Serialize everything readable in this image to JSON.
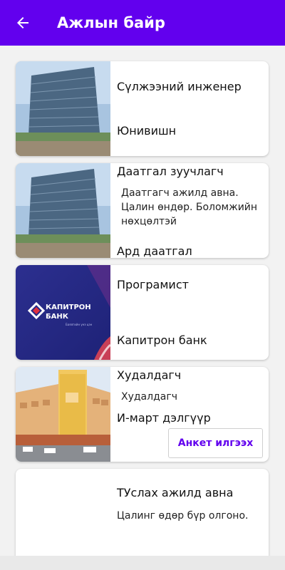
{
  "appbar": {
    "title": "Ажлын байр",
    "back_icon": "arrow-left-icon",
    "color": "#6200ee"
  },
  "jobs": [
    {
      "title": "Сүлжээний инженер",
      "description": "",
      "company": "Юнивишн",
      "image": "office-tower-photo"
    },
    {
      "title": "Даатгал зуучлагч",
      "description": "Даатгагч ажилд авна. Цалин өндөр. Боломжийн нөхцөлтэй",
      "company": "Ард даатгал",
      "image": "office-tower-photo"
    },
    {
      "title": "Програмист",
      "description": "",
      "company": "Капитрон банк",
      "image": "capitron-bank-logo",
      "logo_text_1": "КАПИТРОН",
      "logo_text_2": "БАНК",
      "logo_tagline": "Баялгийн үнэ цэн"
    },
    {
      "title": "Худалдагч",
      "description": "Худалдагч",
      "company": "И-март дэлгүүр",
      "image": "emart-store-photo",
      "apply_label": "Анкет илгээх"
    },
    {
      "title": "ТУслах ажилд авна",
      "description": "Цалинг өдөр бүр олгоно.",
      "company": "",
      "image": ""
    }
  ]
}
